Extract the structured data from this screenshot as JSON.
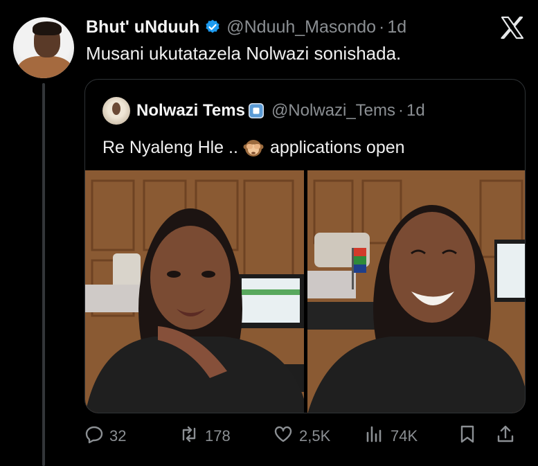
{
  "tweet": {
    "author_name": "Bhut' uNduuh",
    "handle": "@Nduuh_Masondo",
    "separator": "·",
    "time": "1d",
    "text": "Musani ukutatazela Nolwazi sonishada."
  },
  "quoted_tweet": {
    "author_name": "Nolwazi Tems",
    "handle": "@Nolwazi_Tems",
    "separator": "·",
    "time": "1d",
    "text_before": "Re Nyaleng Hle ..",
    "emoji": "see-no-evil-monkey",
    "text_after": "applications open",
    "media_count": 2
  },
  "actions": {
    "replies": "32",
    "reposts": "178",
    "likes": "2,5K",
    "views": "74K"
  },
  "colors": {
    "background": "#000000",
    "text": "#e7e9ea",
    "secondary": "#8b8f93",
    "verified": "#1d9bf0",
    "border": "#2f3336"
  },
  "icons": [
    "x-logo-icon",
    "verified-icon",
    "reply-icon",
    "repost-icon",
    "like-icon",
    "views-icon",
    "bookmark-icon",
    "share-icon"
  ]
}
